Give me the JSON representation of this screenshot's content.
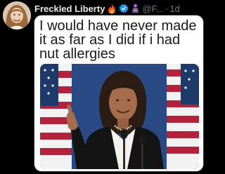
{
  "tweet": {
    "display_name": "Freckled Liberty",
    "handle": "@F...",
    "separator": "·",
    "time": "1d",
    "badges": [
      "fire-icon",
      "verified-badge-icon",
      "person-icon"
    ],
    "meme_text": "I would have never made it as far as I did if i had nut allergies"
  },
  "colors": {
    "background": "#000000",
    "name_text": "#e7e9ea",
    "muted_text": "#71767b",
    "verified_blue": "#1d9bf0",
    "flag_red": "#b3223b",
    "flag_blue": "#1d3a6b"
  }
}
